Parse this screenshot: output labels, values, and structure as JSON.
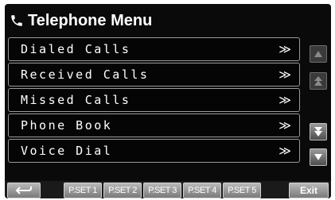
{
  "header": {
    "title": "Telephone Menu",
    "icon": "phone-icon"
  },
  "menu": {
    "items": [
      {
        "label": "Dialed Calls",
        "chevron": "≫"
      },
      {
        "label": "Received Calls",
        "chevron": "≫"
      },
      {
        "label": "Missed Calls",
        "chevron": "≫"
      },
      {
        "label": "Phone Book",
        "chevron": "≫"
      },
      {
        "label": "Voice Dial",
        "chevron": "≫"
      }
    ]
  },
  "scroll": {
    "up_icon": "triangle-up-icon",
    "page_up_icon": "double-triangle-up-icon",
    "page_down_icon": "double-triangle-down-icon",
    "down_icon": "triangle-down-icon"
  },
  "bottom_bar": {
    "back_icon": "return-arrow-icon",
    "presets": [
      "P.SET 1",
      "P.SET 2",
      "P.SET 3",
      "P.SET 4",
      "P.SET 5"
    ],
    "exit_label": "Exit"
  },
  "colors": {
    "background": "#0a0a0a",
    "text": "#ffffff",
    "button": "#9a9a9a",
    "border": "#9a9a9a"
  }
}
